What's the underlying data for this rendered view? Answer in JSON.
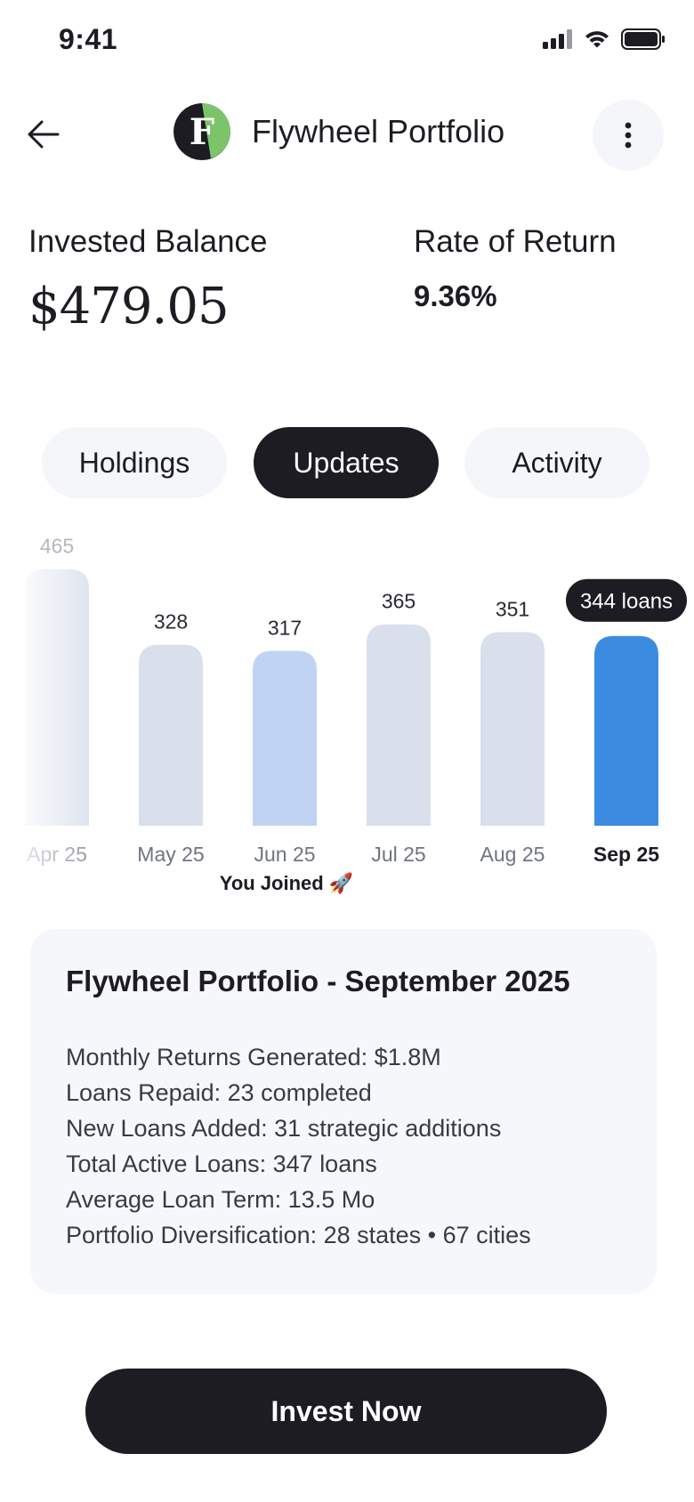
{
  "status_bar": {
    "time": "9:41"
  },
  "header": {
    "title": "Flywheel Portfolio",
    "logo_letter": "F"
  },
  "stats": {
    "balance_label": "Invested Balance",
    "balance_value": "$479.05",
    "return_label": "Rate of Return",
    "return_value": "9.36%"
  },
  "tabs": [
    {
      "label": "Holdings",
      "active": false
    },
    {
      "label": "Updates",
      "active": true
    },
    {
      "label": "Activity",
      "active": false
    }
  ],
  "chart_data": {
    "type": "bar",
    "categories": [
      "Apr 25",
      "May 25",
      "Jun 25",
      "Jul 25",
      "Aug 25",
      "Sep 25"
    ],
    "values": [
      465,
      328,
      317,
      365,
      351,
      344
    ],
    "selected_label": "344 loans",
    "selected_category": "Sep 25",
    "joined_category": "Jun 25",
    "joined_label": "You Joined 🚀",
    "colors": {
      "default": "#d9e0ec",
      "joined": "#c0d3f2",
      "selected": "#3b8ce0",
      "tooltip": "#1c1c22"
    }
  },
  "update_card": {
    "title": "Flywheel Portfolio - September 2025",
    "lines": [
      "Monthly Returns Generated: $1.8M",
      "Loans Repaid: 23 completed",
      "New Loans Added: 31 strategic additions",
      "Total Active Loans: 347 loans",
      "Average Loan Term: 13.5 Mo",
      "Portfolio Diversification: 28 states • 67 cities"
    ]
  },
  "cta": {
    "label": "Invest Now"
  },
  "colors": {
    "primary_dark": "#1c1c22",
    "logo_green": "#7cc46a",
    "pill_bg": "#f4f6fa"
  }
}
